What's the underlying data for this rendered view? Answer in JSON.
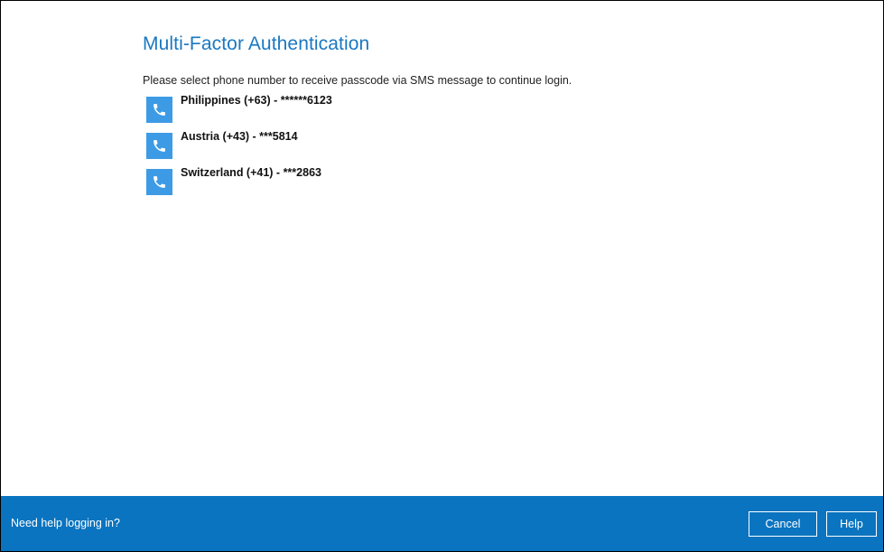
{
  "dialog": {
    "title": "Multi-Factor Authentication",
    "instruction": "Please select phone number to receive passcode via SMS message to continue login."
  },
  "phones": [
    {
      "label": "Philippines (+63) - ******6123",
      "icon": "phone-icon"
    },
    {
      "label": "Austria (+43) - ***5814",
      "icon": "phone-icon"
    },
    {
      "label": "Switzerland (+41) - ***2863",
      "icon": "phone-icon"
    }
  ],
  "footer": {
    "help_link": "Need help logging in?",
    "cancel_label": "Cancel",
    "help_label": "Help"
  },
  "colors": {
    "accent": "#1a78c2",
    "icon_bg": "#3d9be6",
    "footer_bg": "#0a74c0"
  }
}
